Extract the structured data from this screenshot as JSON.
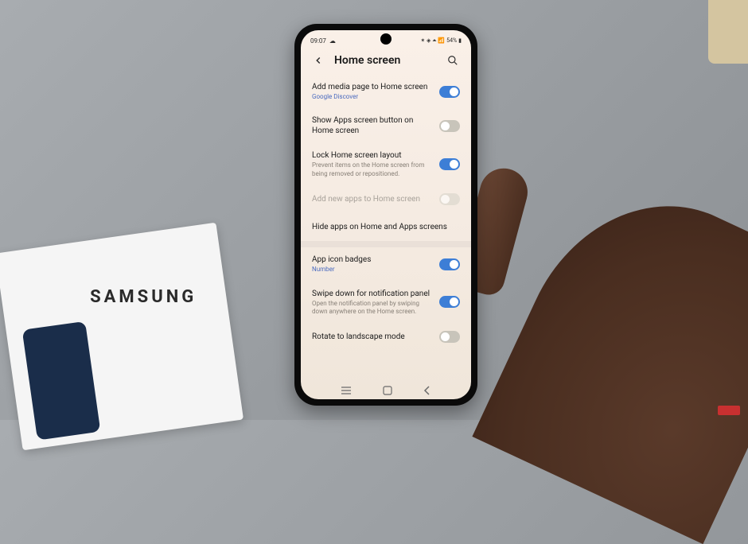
{
  "decoration": {
    "box_brand": "SAMSUNG"
  },
  "status_bar": {
    "time": "09:07",
    "battery": "54%"
  },
  "header": {
    "title": "Home screen"
  },
  "settings": {
    "media_page": {
      "title": "Add media page to Home screen",
      "subtitle": "Google Discover",
      "enabled": true
    },
    "apps_button": {
      "title": "Show Apps screen button on Home screen",
      "enabled": false
    },
    "lock_layout": {
      "title": "Lock Home screen layout",
      "subtitle": "Prevent items on the Home screen from being removed or repositioned.",
      "enabled": true
    },
    "add_new_apps": {
      "title": "Add new apps to Home screen",
      "enabled": false
    },
    "hide_apps": {
      "title": "Hide apps on Home and Apps screens"
    },
    "icon_badges": {
      "title": "App icon badges",
      "subtitle": "Number",
      "enabled": true
    },
    "swipe_notification": {
      "title": "Swipe down for notification panel",
      "subtitle": "Open the notification panel by swiping down anywhere on the Home screen.",
      "enabled": true
    },
    "rotate": {
      "title": "Rotate to landscape mode",
      "enabled": false
    }
  }
}
